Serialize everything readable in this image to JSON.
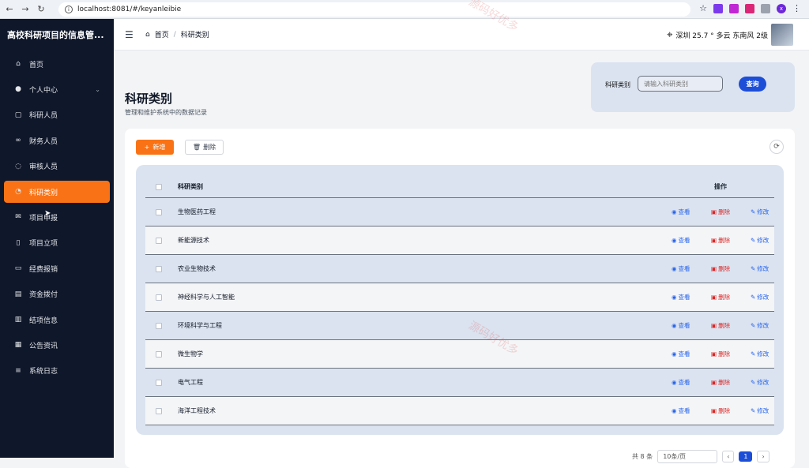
{
  "browser": {
    "url": "localhost:8081/#/keyanleibie",
    "profile_initial": "x"
  },
  "sidebar": {
    "title": "高校科研项目的信息管...",
    "items": [
      {
        "label": "首页",
        "icon": "home-icon"
      },
      {
        "label": "个人中心",
        "icon": "user-icon",
        "has_children": true
      },
      {
        "label": "科研人员",
        "icon": "document-icon"
      },
      {
        "label": "财务人员",
        "icon": "link-icon"
      },
      {
        "label": "审核人员",
        "icon": "chat-icon"
      },
      {
        "label": "科研类别",
        "icon": "pie-icon",
        "active": true
      },
      {
        "label": "项目申报",
        "icon": "mail-icon"
      },
      {
        "label": "项目立项",
        "icon": "book-icon"
      },
      {
        "label": "经费报销",
        "icon": "card-icon"
      },
      {
        "label": "资金拨付",
        "icon": "monitor-icon"
      },
      {
        "label": "结项信息",
        "icon": "building-icon"
      },
      {
        "label": "公告资讯",
        "icon": "news-icon"
      },
      {
        "label": "系统日志",
        "icon": "database-icon"
      }
    ]
  },
  "topbar": {
    "breadcrumb_home": "首页",
    "breadcrumb_separator": "/",
    "breadcrumb_current": "科研类别",
    "weather": "深圳 25.7 ° 多云 东南风 2级"
  },
  "page": {
    "title": "科研类别",
    "subtitle": "管理和维护系统中的数据记录"
  },
  "search": {
    "label": "科研类别",
    "placeholder": "请输入科研类别",
    "button": "查询"
  },
  "toolbar": {
    "add_label": "新增",
    "delete_label": "删除"
  },
  "table": {
    "columns": [
      "科研类别",
      "操作"
    ],
    "rows": [
      "生物医药工程",
      "新能源技术",
      "农业生物技术",
      "神经科学与人工智能",
      "环境科学与工程",
      "微生物学",
      "电气工程",
      "海洋工程技术"
    ],
    "actions": {
      "view": "查看",
      "delete": "删除",
      "edit": "修改"
    }
  },
  "pagination": {
    "total": "共 8 条",
    "page_size": "10条/页",
    "current_page": "1"
  },
  "watermark": "源码好优多",
  "colors": {
    "sidebar_bg": "#0f172a",
    "accent": "#f97316",
    "primary": "#1d4ed8",
    "danger": "#dc2626"
  }
}
